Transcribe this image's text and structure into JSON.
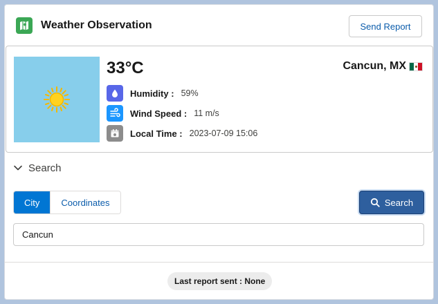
{
  "header": {
    "title": "Weather Observation",
    "app_icon": "map-icon",
    "send_label": "Send Report"
  },
  "weather": {
    "temperature": "33°C",
    "location": "Cancun, MX",
    "flag": "mexico-flag-icon",
    "condition_icon": "sun-icon",
    "sky_color": "#87ceeb",
    "humidity_label": "Humidity :",
    "humidity_value": "59%",
    "wind_label": "Wind Speed :",
    "wind_value": "11 m/s",
    "time_label": "Local Time :",
    "time_value": "2023-07-09 15:06"
  },
  "search": {
    "section_title": "Search",
    "tabs": [
      {
        "label": "City",
        "active": true
      },
      {
        "label": "Coordinates",
        "active": false
      }
    ],
    "button_label": "Search",
    "city_value": "Cancun"
  },
  "footer": {
    "last_report": "Last report sent : None"
  },
  "colors": {
    "accent": "#0176d3",
    "search_button": "#2e5f9e",
    "app_icon": "#3ba755",
    "humidity_icon": "#5867e8",
    "wind_icon": "#1b96ff",
    "time_icon": "#8c8c8c"
  }
}
